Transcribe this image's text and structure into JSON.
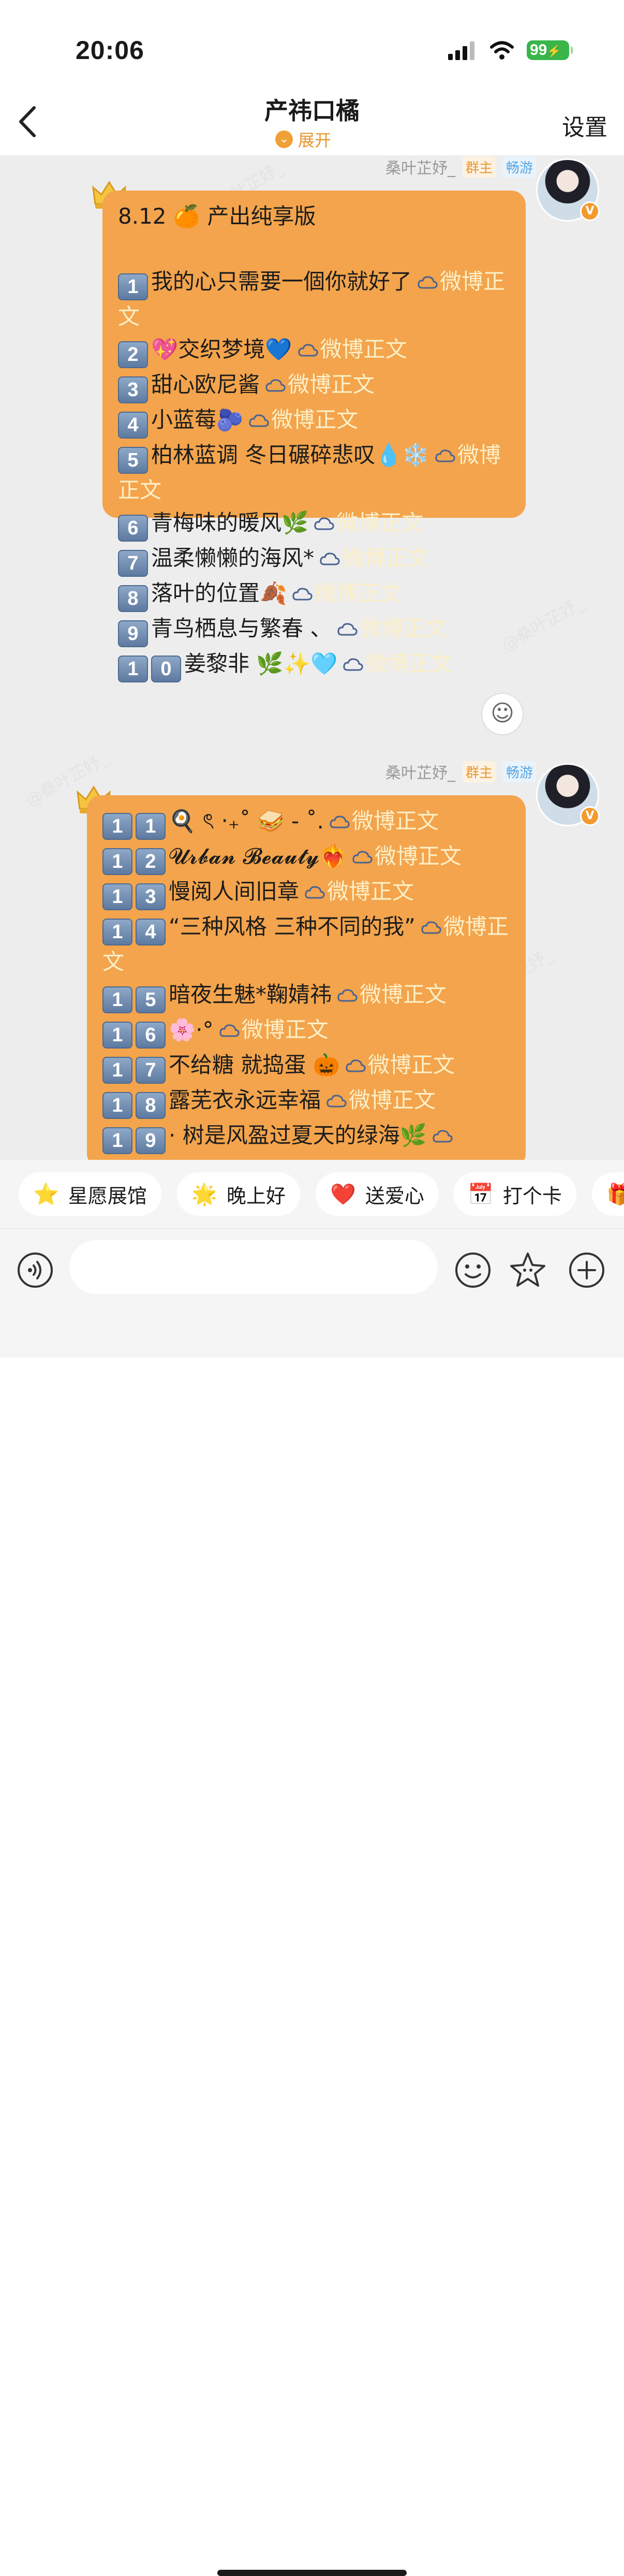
{
  "status_bar": {
    "time": "20:06",
    "battery": "99"
  },
  "header": {
    "title": "产祎口橘",
    "expand_label": "展开",
    "settings_label": "设置"
  },
  "messages": [
    {
      "sender": "桑叶芷妤_",
      "role": "群主",
      "game": "畅游",
      "lines": [
        {
          "text": "8.12 🍊 产出纯享版"
        },
        {
          "text": ""
        },
        {
          "num": "1",
          "text": "我的心只需要一個你就好了",
          "link": "微博正文",
          "wrap": true
        },
        {
          "num": "2",
          "text": "💖交织梦境💙",
          "link": "微博正文"
        },
        {
          "num": "3",
          "text": "甜心欧尼酱",
          "link": "微博正文"
        },
        {
          "num": "4",
          "text": "小蓝莓🫐",
          "link": "微博正文"
        },
        {
          "num": "5",
          "text": "柏林蓝调 冬日碾碎悲叹💧❄️",
          "link": "微博正文",
          "wrap": true
        },
        {
          "num": "6",
          "text": "青梅味的暖风🌿",
          "link": "微博正文"
        },
        {
          "num": "7",
          "text": "温柔懒懒的海风*",
          "link": "微博正文"
        },
        {
          "num": "8",
          "text": "落叶的位置🍂",
          "link": "微博正文"
        },
        {
          "num": "9",
          "text": "青鸟栖息与繁春 、",
          "link": "微博正文"
        },
        {
          "num": "10",
          "text": "姜黎非 🌿✨🩵",
          "link": "微博正文"
        }
      ]
    },
    {
      "sender": "桑叶芷妤_",
      "role": "群主",
      "game": "畅游",
      "lines": [
        {
          "num": "11",
          "text": "🍳 ৎ ‧₊˚ 🥪 - ˚.",
          "link": "微博正文"
        },
        {
          "num": "12",
          "text": "𝓤𝓻𝓫𝓪𝓷 𝓑𝓮𝓪𝓾𝓽𝔂❤️‍🔥",
          "link": "微博正文",
          "wrap": true
        },
        {
          "num": "13",
          "text": "慢阅人间旧章",
          "link": "微博正文"
        },
        {
          "num": "14",
          "text": "“三种风格 三种不同的我”",
          "link": "微博正文",
          "wrap": true
        },
        {
          "num": "15",
          "text": "暗夜生魅*鞠婧祎",
          "link": "微博正文"
        },
        {
          "num": "16",
          "text": "🌸·°",
          "link": "微博正文"
        },
        {
          "num": "17",
          "text": "不给糖 就捣蛋 🎃",
          "link": "微博正文"
        },
        {
          "num": "18",
          "text": "露芜衣永远幸福",
          "link": "微博正文"
        },
        {
          "num": "19",
          "text": "· 树是风盈过夏天的绿海🌿",
          "link": ""
        }
      ]
    }
  ],
  "quick_actions": [
    {
      "icon": "⭐",
      "label": "星愿展馆"
    },
    {
      "icon": "🌟",
      "label": "晚上好"
    },
    {
      "icon": "❤️",
      "label": "送爱心"
    },
    {
      "icon": "📅",
      "label": "打个卡"
    },
    {
      "icon": "🎁",
      "label": ""
    }
  ],
  "input": {
    "placeholder": ""
  },
  "watermark": "@桑叶芷妤_",
  "colors": {
    "bubble": "#f3a44c",
    "accent": "#f0a136",
    "link": "#fcefc7",
    "chat_bg": "#ededed"
  }
}
